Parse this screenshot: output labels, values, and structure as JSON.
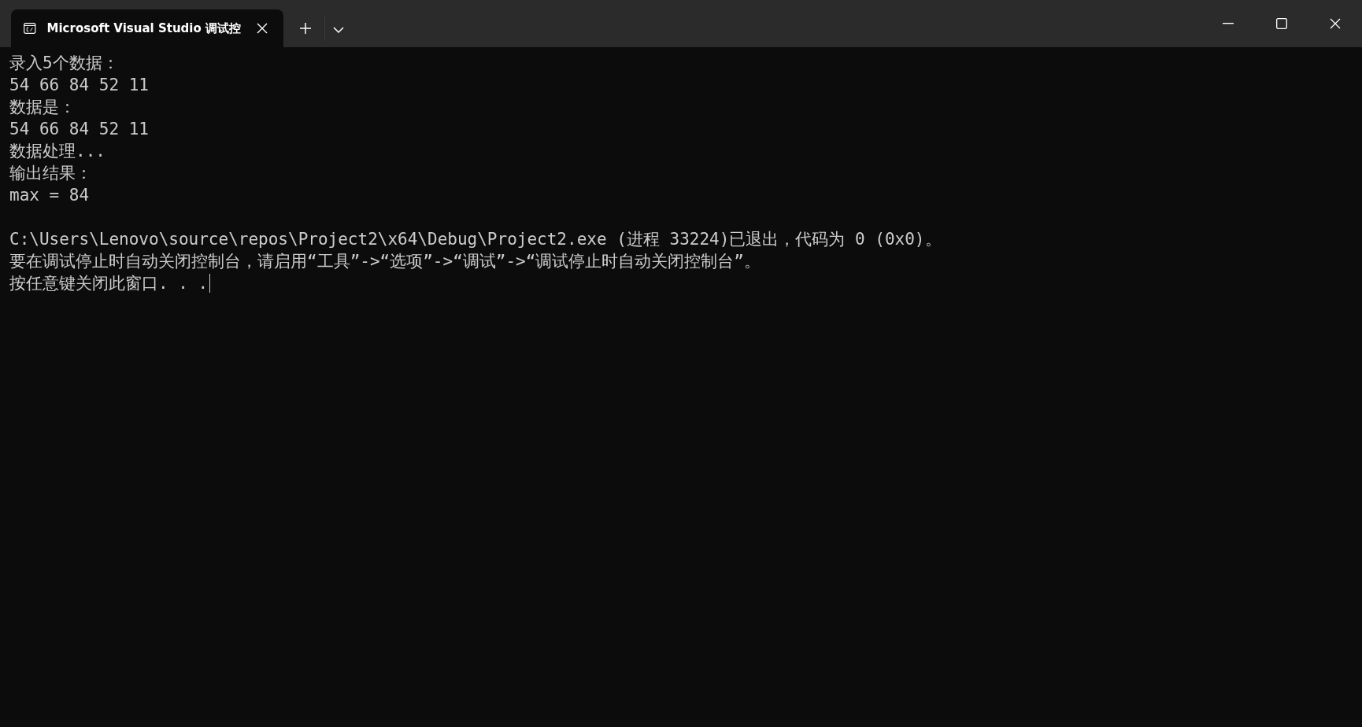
{
  "tabs": [
    {
      "title": "Microsoft Visual Studio 调试控",
      "selected": true
    }
  ],
  "console": {
    "output_lines": [
      "录入5个数据：",
      "54 66 84 52 11",
      "数据是：",
      "54 66 84 52 11",
      "数据处理...",
      "输出结果：",
      "max = 84"
    ],
    "exit_lines": [
      "C:\\Users\\Lenovo\\source\\repos\\Project2\\x64\\Debug\\Project2.exe (进程 33224)已退出，代码为 0 (0x0)。",
      "要在调试停止时自动关闭控制台，请启用“工具”->“选项”->“调试”->“调试停止时自动关闭控制台”。",
      "按任意键关闭此窗口. . ."
    ]
  }
}
